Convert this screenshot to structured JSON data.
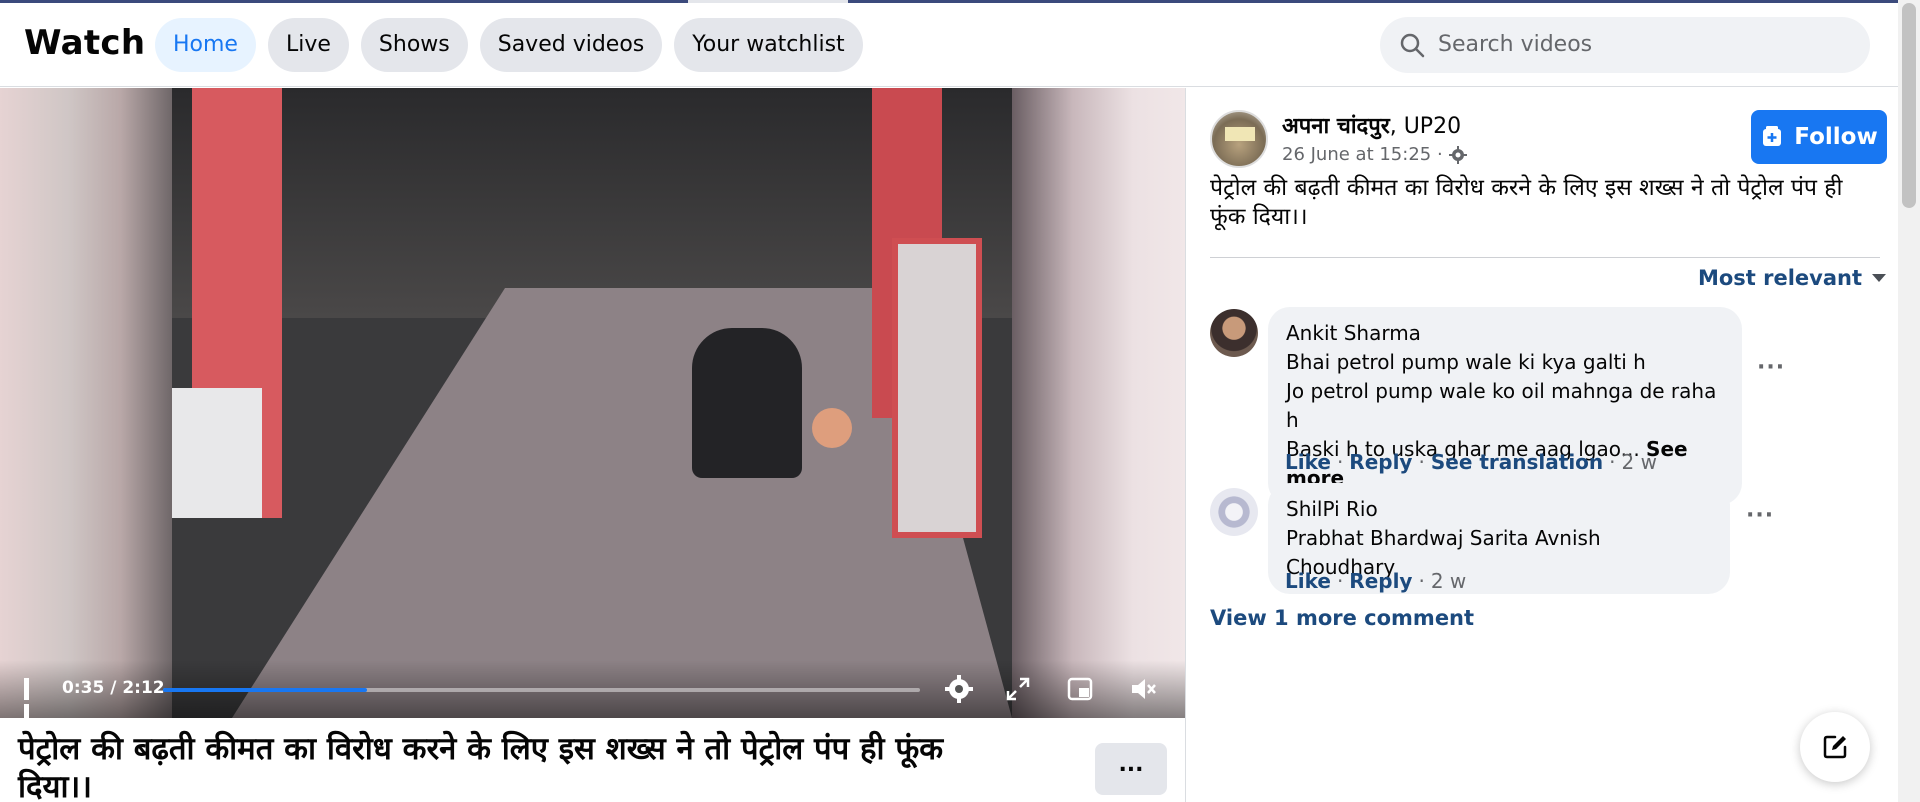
{
  "header": {
    "title": "Watch",
    "tabs": [
      {
        "label": "Home",
        "active": true
      },
      {
        "label": "Live",
        "active": false
      },
      {
        "label": "Shows",
        "active": false
      },
      {
        "label": "Saved videos",
        "active": false
      },
      {
        "label": "Your watchlist",
        "active": false
      }
    ],
    "search_placeholder": "Search videos"
  },
  "video": {
    "time": "0:35 / 2:12",
    "progress_percent": 27,
    "title": "पेट्रोल की बढ़ती कीमत का विरोध करने के लिए इस शख्स ने तो पेट्रोल पंप ही फूंक दिया।।",
    "more_label": "...",
    "controls": [
      "pause-icon",
      "settings-icon",
      "fullscreen-icon",
      "picture-in-picture-icon",
      "mute-icon"
    ]
  },
  "post": {
    "page_name": "अपना चांदपुर",
    "page_suffix": ", UP20",
    "date": "26 June at 15:25 ·",
    "follow_label": "Follow",
    "text": "पेट्रोल की बढ़ती कीमत का विरोध करने के लिए इस शख्स ने तो पेट्रोल पंप ही फूंक दिया।।",
    "sort_label": "Most relevant"
  },
  "comments": [
    {
      "author": "Ankit Sharma",
      "lines": [
        "Bhai petrol pump wale ki kya galti h",
        "Jo petrol pump wale ko oil mahnga de raha h",
        "Baski h to uska ghar me aag lgao..."
      ],
      "see_more": "See more",
      "like": "Like",
      "reply": "Reply",
      "translate": "See translation",
      "age": "2 w"
    },
    {
      "author": "ShilPi Rio",
      "lines": [
        "Prabhat Bhardwaj Sarita Avnish Choudhary"
      ],
      "like": "Like",
      "reply": "Reply",
      "age": "2 w"
    }
  ],
  "view_more": "View 1 more comment",
  "colors": {
    "accent": "#1877f2",
    "link": "#1c4a7e",
    "bubble": "#f0f2f5",
    "pill": "#e4e6eb"
  }
}
